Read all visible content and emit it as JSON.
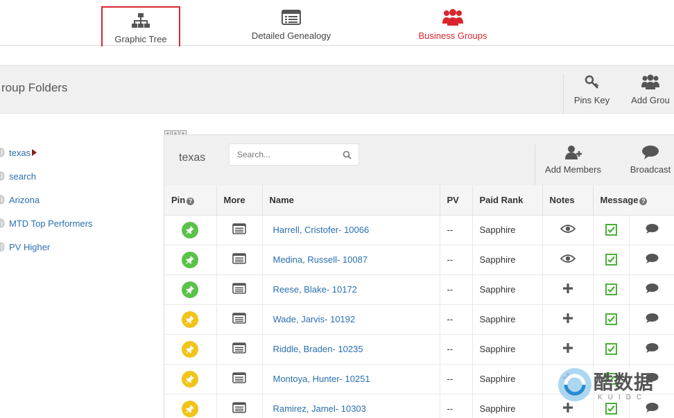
{
  "topnav": {
    "items": [
      {
        "label": "Graphic Tree",
        "icon": "sitemap-icon"
      },
      {
        "label": "Detailed Genealogy",
        "icon": "list-card-icon"
      },
      {
        "label": "Business Groups",
        "icon": "group-icon",
        "color": "#d9262c"
      }
    ]
  },
  "group_folders": {
    "title": "roup Folders",
    "tools": [
      {
        "label": "Pins Key",
        "icon": "key-icon"
      },
      {
        "label": "Add Grou",
        "icon": "users-icon"
      }
    ]
  },
  "sidebar": {
    "items": [
      {
        "label": "texas"
      },
      {
        "label": "search"
      },
      {
        "label": "Arizona"
      },
      {
        "label": "MTD Top Performers"
      },
      {
        "label": "PV Higher"
      }
    ]
  },
  "panel": {
    "title": "texas",
    "search_placeholder": "Search...",
    "tools": [
      {
        "label": "Add Members",
        "icon": "add-user-icon"
      },
      {
        "label": "Broadcast",
        "icon": "chat-icon"
      }
    ]
  },
  "table": {
    "headers": {
      "pin": "Pin",
      "more": "More",
      "name": "Name",
      "pv": "PV",
      "rank": "Paid Rank",
      "notes": "Notes",
      "message": "Message"
    },
    "rows": [
      {
        "pin": "green",
        "name": "Harrell, Cristofer- 10066",
        "pv": "--",
        "rank": "Sapphire",
        "note": "eye"
      },
      {
        "pin": "green",
        "name": "Medina, Russell- 10087",
        "pv": "--",
        "rank": "Sapphire",
        "note": "eye"
      },
      {
        "pin": "green",
        "name": "Reese, Blake- 10172",
        "pv": "--",
        "rank": "Sapphire",
        "note": "plus"
      },
      {
        "pin": "yellow",
        "name": "Wade, Jarvis- 10192",
        "pv": "--",
        "rank": "Sapphire",
        "note": "plus"
      },
      {
        "pin": "yellow",
        "name": "Riddle, Braden- 10235",
        "pv": "--",
        "rank": "Sapphire",
        "note": "plus"
      },
      {
        "pin": "yellow",
        "name": "Montoya, Hunter- 10251",
        "pv": "--",
        "rank": "Sapphire",
        "note": "plus"
      },
      {
        "pin": "yellow",
        "name": "Ramirez, Jamel- 10303",
        "pv": "--",
        "rank": "Sapphire",
        "note": "plus"
      }
    ]
  },
  "colors": {
    "accent_red": "#d9262c",
    "link_blue": "#2a6fb0",
    "pin_green": "#5ac24a",
    "pin_yellow": "#f0c419",
    "check_green": "#4bae3a"
  },
  "watermark": {
    "text": "酷数据",
    "sub": "KUIDC"
  }
}
